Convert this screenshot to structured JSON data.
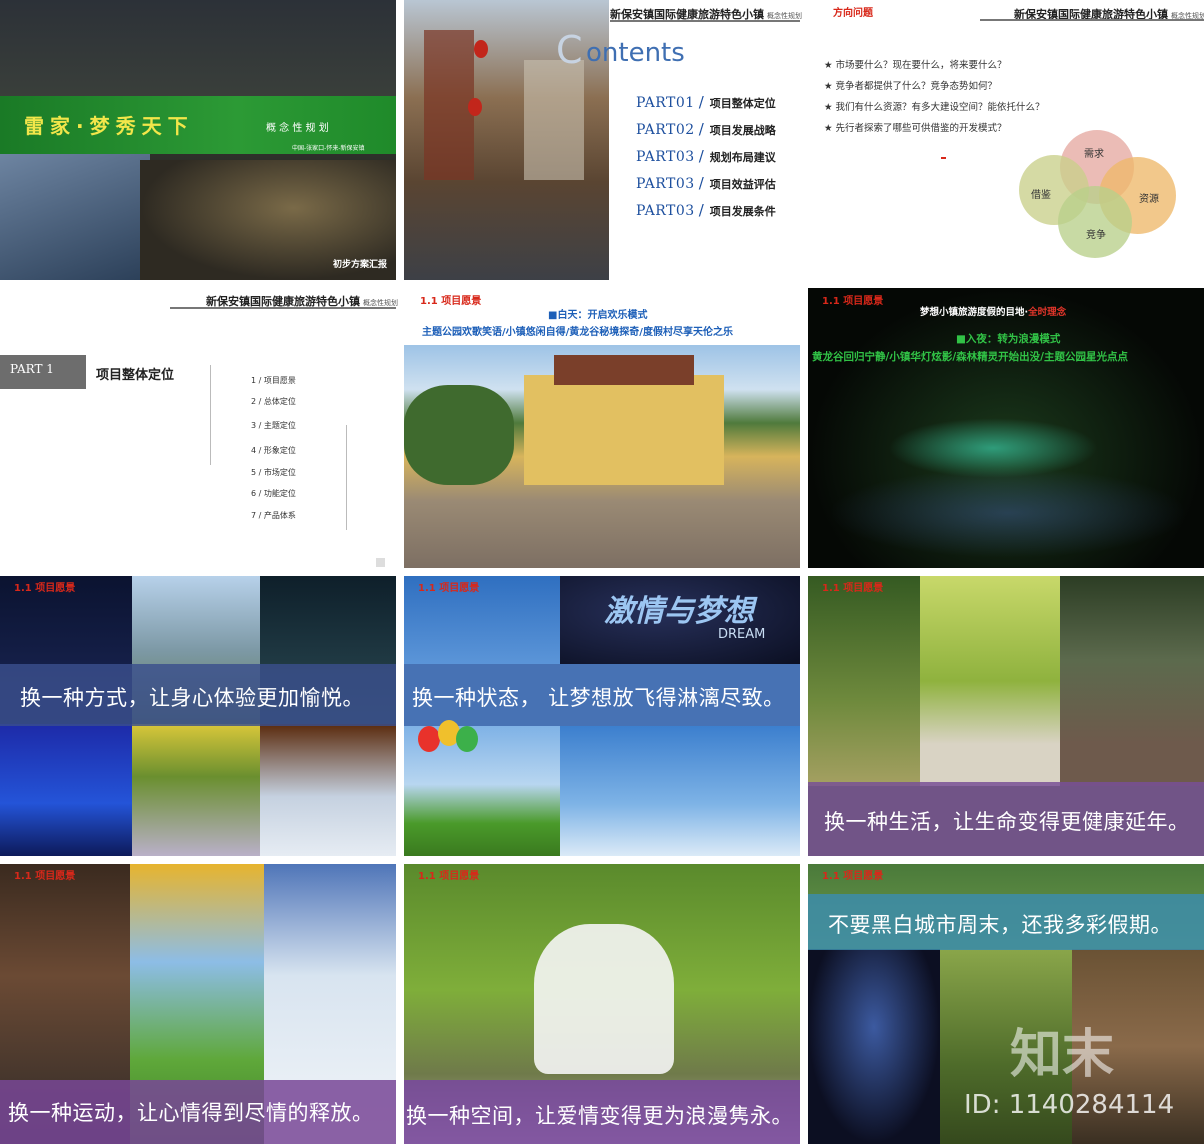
{
  "slide1": {
    "title": "雷家·梦秀天下",
    "subtitle": "概 念 性 规 划",
    "location": "中国-张家口-怀来-新保安镇",
    "footer": "初步方案汇报"
  },
  "slide2": {
    "contents_c": "C",
    "contents_rest": "ontents",
    "header_title": "新保安镇国际健康旅游特色小镇",
    "header_sub": "概念性规划",
    "toc": [
      {
        "part": "PART01",
        "label": "项目整体定位"
      },
      {
        "part": "PART02",
        "label": "项目发展战略"
      },
      {
        "part": "PART03",
        "label": "规划布局建议"
      },
      {
        "part": "PART03",
        "label": "项目效益评估"
      },
      {
        "part": "PART03",
        "label": "项目发展条件"
      }
    ]
  },
  "slide3": {
    "tag": "方向问题",
    "header_title": "新保安镇国际健康旅游特色小镇",
    "header_sub": "概念性规划",
    "questions": [
      "★ 市场要什么？现在要什么，将来要什么？",
      "★ 竞争者都提供了什么？竞争态势如何？",
      "★ 我们有什么资源？有多大建设空间？能依托什么？",
      "★ 先行者探索了哪些可供借鉴的开发模式？"
    ],
    "venn": [
      "需求",
      "借鉴",
      "资源",
      "竞争"
    ]
  },
  "slide4": {
    "header_title": "新保安镇国际健康旅游特色小镇",
    "header_sub": "概念性规划",
    "part_label": "PART 1",
    "part_title": "项目整体定位",
    "items": [
      "1 /  项目愿景",
      "2 /  总体定位",
      "3 /  主题定位",
      "4 /  形象定位",
      "5 /  市场定位",
      "6 /  功能定位",
      "7 /  产品体系"
    ]
  },
  "slide5": {
    "tag": "1.1  项目愿景",
    "mode": "■白天：开启欢乐模式",
    "line": "主题公园欢歌笑语/小镇悠闲自得/黄龙谷秘境探奇/度假村尽享天伦之乐"
  },
  "slide6": {
    "tag": "1.1  项目愿景",
    "headline_a": "梦想小镇旅游度假的目地·",
    "headline_b": "全时理念",
    "mode": "■入夜：转为浪漫模式",
    "line": "黄龙谷回归宁静/小镇华灯炫影/森林精灵开始出没/主题公园星光点点"
  },
  "slide7": {
    "tag": "1.1  项目愿景",
    "caption": "换一种方式，让身心体验更加愉悦。"
  },
  "slide8": {
    "tag": "1.1  项目愿景",
    "caption": "换一种状态， 让梦想放飞得淋漓尽致。",
    "poster_title": "激情与梦想",
    "poster_en": "DREAM"
  },
  "slide9": {
    "tag": "1.1  项目愿景",
    "caption": "换一种生活，让生命变得更健康延年。"
  },
  "slide10": {
    "tag": "1.1  项目愿景",
    "caption": "换一种运动，让心情得到尽情的释放。"
  },
  "slide11": {
    "tag": "1.1  项目愿景",
    "caption": "换一种空间，让爱情变得更为浪漫隽永。"
  },
  "slide12": {
    "tag": "1.1  项目愿景",
    "caption": "不要黑白城市周末，还我多彩假期。"
  },
  "watermark": {
    "brand": "知末",
    "id": "ID: 1140284114"
  },
  "colors": {
    "accent_red": "#d8281a",
    "toc_blue": "#1d4f9e",
    "green_band": "#1f8a2a"
  }
}
